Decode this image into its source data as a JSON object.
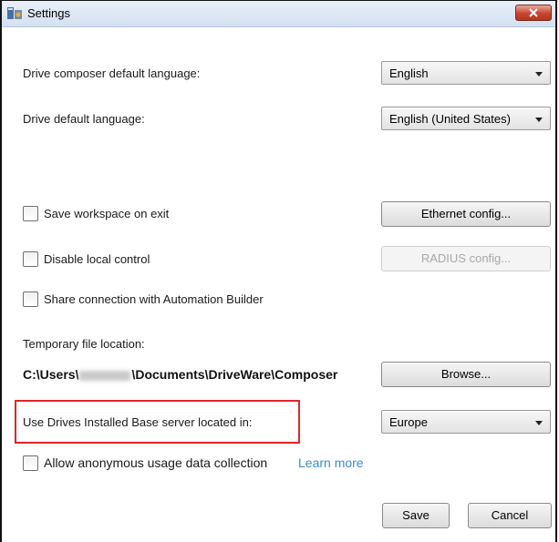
{
  "window": {
    "title": "Settings",
    "close_icon": "close-x-icon",
    "app_icon": "settings-app-icon"
  },
  "language": {
    "composer_label": "Drive composer default language:",
    "composer_value": "English",
    "drive_label": "Drive default language:",
    "drive_value": "English (United States)"
  },
  "options": {
    "save_workspace": {
      "label": "Save workspace on exit",
      "checked": false
    },
    "disable_local": {
      "label": "Disable local control",
      "checked": false
    },
    "share_connection": {
      "label": "Share connection with Automation Builder",
      "checked": false
    },
    "anonymous_usage": {
      "label": "Allow anonymous usage data collection",
      "checked": false
    }
  },
  "buttons": {
    "ethernet": "Ethernet config...",
    "radius": "RADIUS config...",
    "browse": "Browse...",
    "save": "Save",
    "cancel": "Cancel"
  },
  "temp": {
    "label": "Temporary file location:",
    "path_prefix": "C:\\Users\\",
    "path_suffix": "\\Documents\\DriveWare\\Composer"
  },
  "server": {
    "label": "Use Drives Installed Base server located in:",
    "value": "Europe"
  },
  "learn_more": "Learn more",
  "colors": {
    "highlight": "#e2242b",
    "link": "#3a8ad8",
    "close_button": "#c7452f"
  }
}
